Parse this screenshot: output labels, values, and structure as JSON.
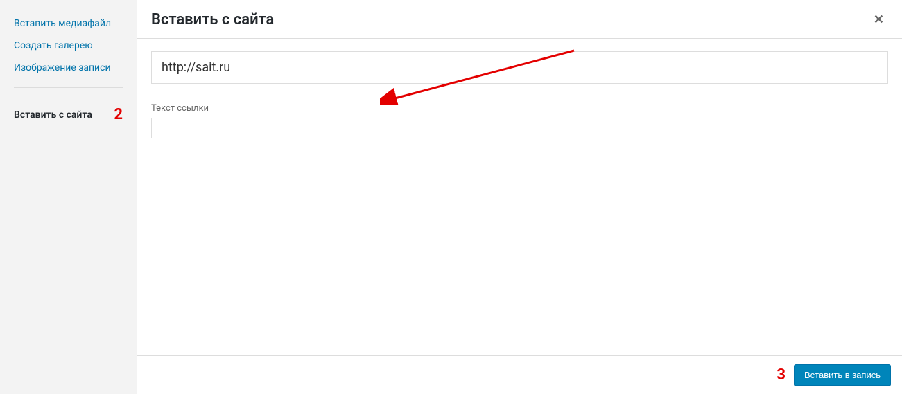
{
  "sidebar": {
    "items": [
      {
        "label": "Вставить медиафайл"
      },
      {
        "label": "Создать галерею"
      },
      {
        "label": "Изображение записи"
      }
    ],
    "active_item": {
      "label": "Вставить с сайта"
    }
  },
  "annotations": {
    "step2": "2",
    "step3": "3"
  },
  "header": {
    "title": "Вставить с сайта"
  },
  "form": {
    "url_value": "http://sait.ru",
    "link_text_label": "Текст ссылки",
    "link_text_value": ""
  },
  "footer": {
    "insert_button_label": "Вставить в запись"
  }
}
